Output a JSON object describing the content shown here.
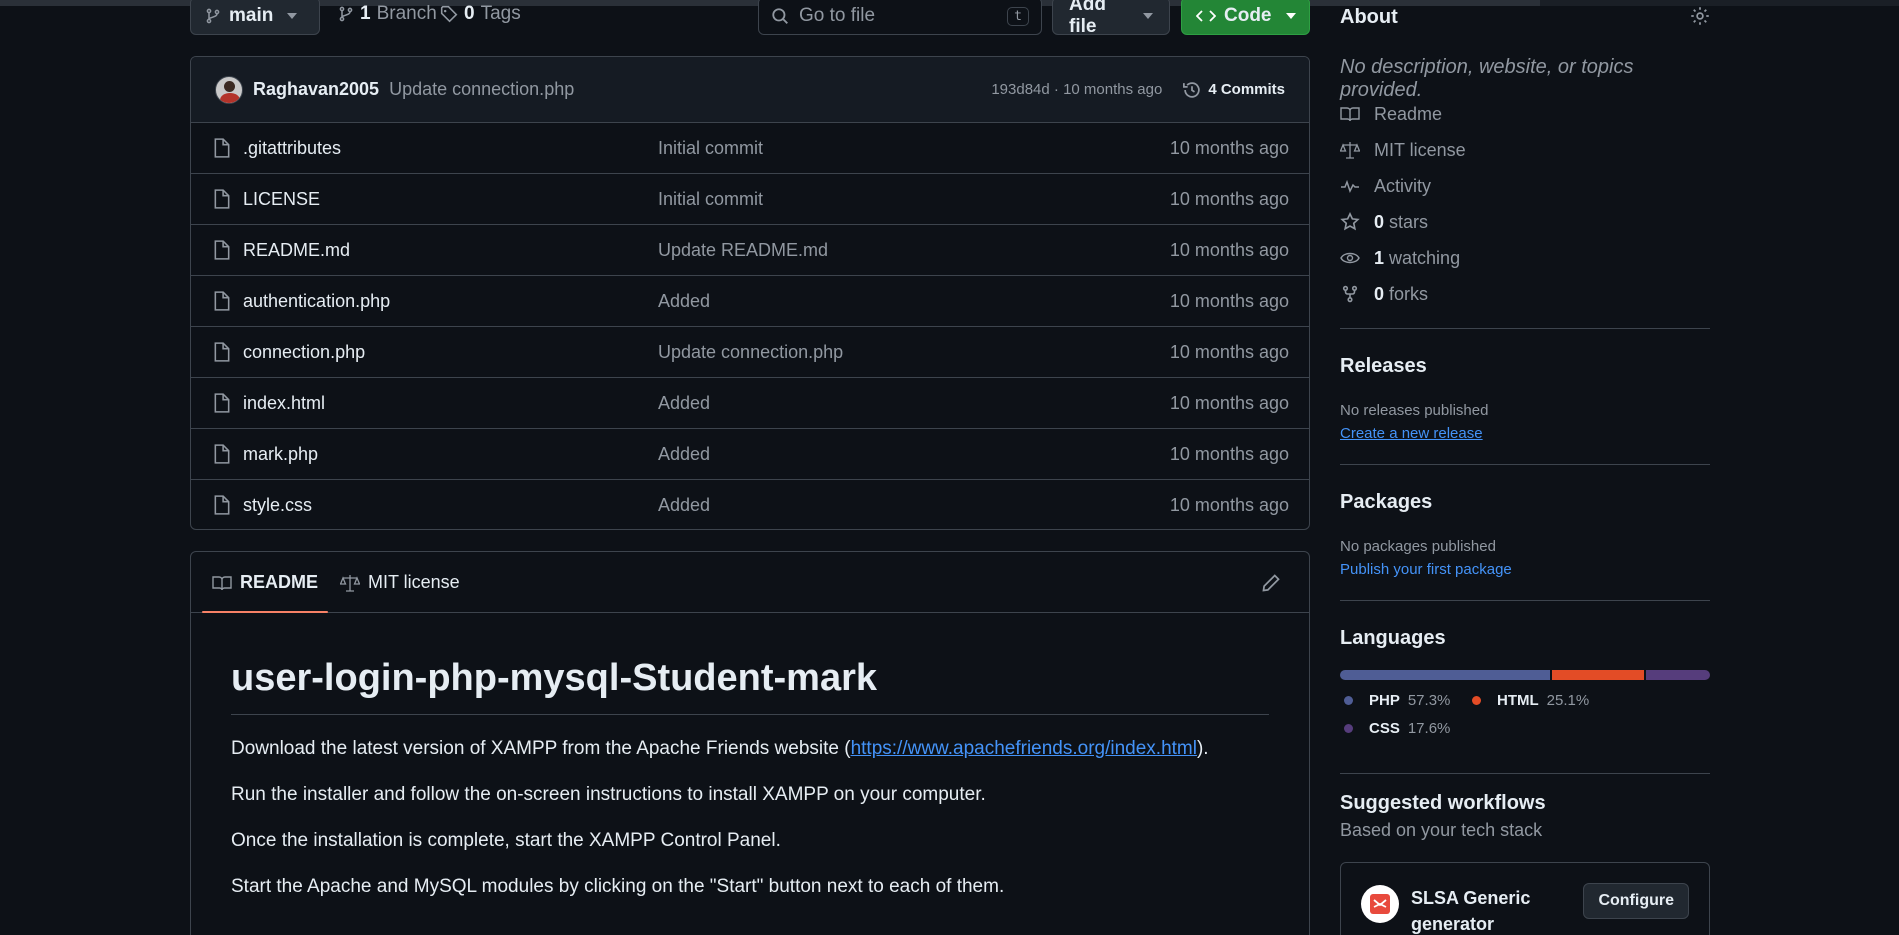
{
  "toolbar": {
    "branch_label": "main",
    "branch_count": "1",
    "branch_word": "Branch",
    "tag_count": "0",
    "tag_word": "Tags",
    "search_placeholder": "Go to file",
    "search_shortcut": "t",
    "add_file_label": "Add file",
    "code_label": "Code"
  },
  "commit": {
    "author": "Raghavan2005",
    "message": "Update connection.php",
    "hash_time": "193d84d · 10 months ago",
    "commits_label": "4 Commits"
  },
  "files": [
    {
      "name": ".gitattributes",
      "message": "Initial commit",
      "date": "10 months ago"
    },
    {
      "name": "LICENSE",
      "message": "Initial commit",
      "date": "10 months ago"
    },
    {
      "name": "README.md",
      "message": "Update README.md",
      "date": "10 months ago"
    },
    {
      "name": "authentication.php",
      "message": "Added",
      "date": "10 months ago"
    },
    {
      "name": "connection.php",
      "message": "Update connection.php",
      "date": "10 months ago"
    },
    {
      "name": "index.html",
      "message": "Added",
      "date": "10 months ago"
    },
    {
      "name": "mark.php",
      "message": "Added",
      "date": "10 months ago"
    },
    {
      "name": "style.css",
      "message": "Added",
      "date": "10 months ago"
    }
  ],
  "readme": {
    "tab_readme": "README",
    "tab_license": "MIT license",
    "title": "user-login-php-mysql-Student-mark",
    "p1_before": "Download the latest version of XAMPP from the Apache Friends website (",
    "p1_link": "https://www.apachefriends.org/index.html",
    "p1_after": ").",
    "p2": "Run the installer and follow the on-screen instructions to install XAMPP on your computer.",
    "p3": "Once the installation is complete, start the XAMPP Control Panel.",
    "p4": "Start the Apache and MySQL modules by clicking on the \"Start\" button next to each of them."
  },
  "about": {
    "title": "About",
    "description": "No description, website, or topics provided.",
    "readme": "Readme",
    "license": "MIT license",
    "activity": "Activity",
    "stars_count": "0",
    "stars_word": "stars",
    "watching_count": "1",
    "watching_word": "watching",
    "forks_count": "0",
    "forks_word": "forks"
  },
  "releases": {
    "title": "Releases",
    "none": "No releases published",
    "create_link": "Create a new release"
  },
  "packages": {
    "title": "Packages",
    "none": "No packages published",
    "publish_link": "Publish your first package"
  },
  "languages": {
    "title": "Languages",
    "items": [
      {
        "name": "PHP",
        "percent": "57.3%",
        "value": 57.3,
        "color": "#4f5d95"
      },
      {
        "name": "HTML",
        "percent": "25.1%",
        "value": 25.1,
        "color": "#e34c26"
      },
      {
        "name": "CSS",
        "percent": "17.6%",
        "value": 17.6,
        "color": "#563d7c"
      }
    ]
  },
  "workflows": {
    "title": "Suggested workflows",
    "subtitle": "Based on your tech stack",
    "card_name_line1": "SLSA Generic",
    "card_name_line2": "generator",
    "configure_label": "Configure"
  },
  "colors": {
    "background": "#0d1117",
    "border": "#3d444d",
    "accent_green": "#238636",
    "link_blue": "#4493f8",
    "tab_underline": "#f78166"
  }
}
